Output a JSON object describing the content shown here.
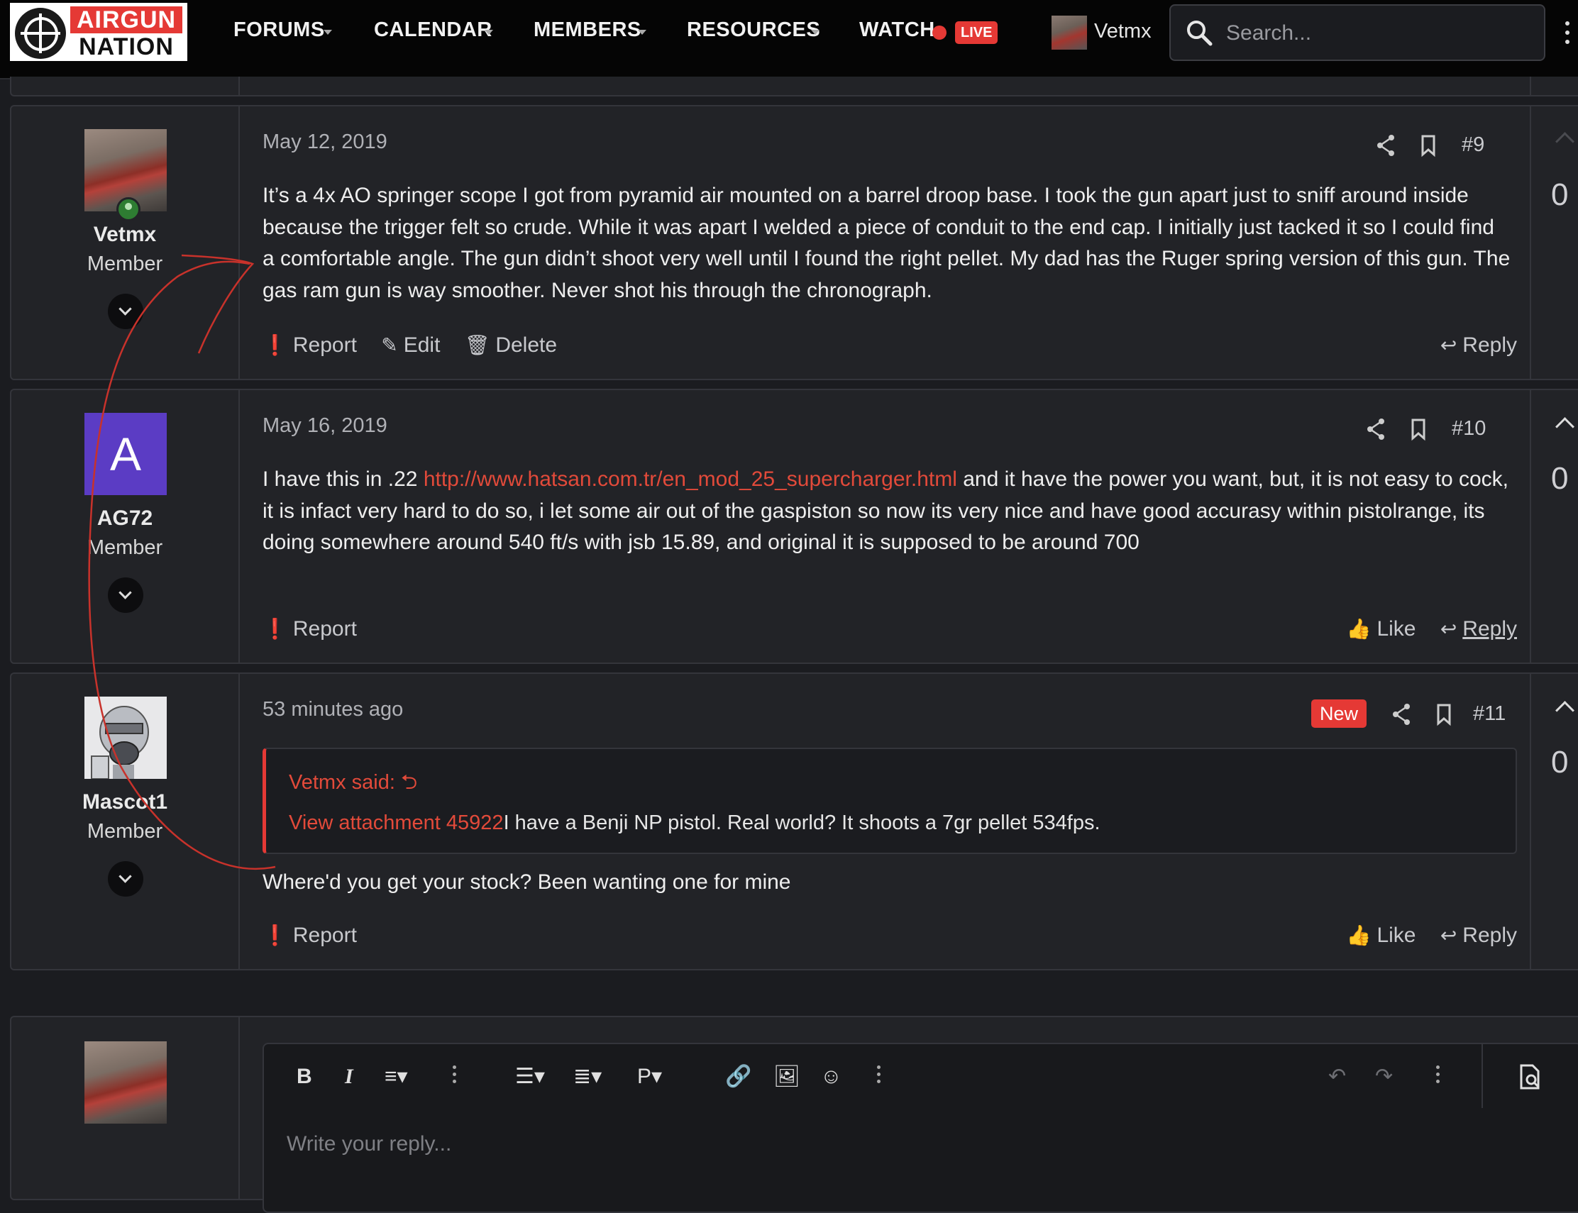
{
  "nav": {
    "logo_top": "AIRGUN",
    "logo_bottom": "NATION",
    "items": [
      "FORUMS",
      "CALENDAR",
      "MEMBERS",
      "RESOURCES"
    ],
    "watch": "WATCH",
    "live": "LIVE",
    "username": "Vetmx",
    "search_placeholder": "Search..."
  },
  "posts": [
    {
      "author": "Vetmx",
      "role": "Member",
      "date": "May 12, 2019",
      "number": "#9",
      "body": "It’s a 4x AO springer scope I got from pyramid air mounted on a barrel droop base. I took the gun apart just to sniff around inside because the trigger felt so crude. While it was apart I welded a piece of conduit to the end cap. I initially just tacked it so I could find a comfortable angle. The gun didn’t shoot very well until I found the right pellet. My dad has the Ruger spring version of this gun. The gas ram gun is way smoother. Never shot his through the chronograph.",
      "actions": [
        "Report",
        "Edit",
        "Delete"
      ],
      "reply": "Reply",
      "votes": "0"
    },
    {
      "author": "AG72",
      "avatar_letter": "A",
      "role": "Member",
      "date": "May 16, 2019",
      "number": "#10",
      "body_before": "I have this in .22 ",
      "link": "http://www.hatsan.com.tr/en_mod_25_supercharger.html",
      "body_after": " and it have the power you want, but, it is not easy to cock, it is infact very hard to do so, i let some air out of the gaspiston so now its very nice and have good accurasy within pistolrange, its doing somewhere around 540 ft/s with jsb 15.89, and original it is supposed to be around 700",
      "report": "Report",
      "like": "Like",
      "reply": "Reply",
      "votes": "0"
    },
    {
      "author": "Mascot1",
      "role": "Member",
      "date": "53 minutes ago",
      "badge": "New",
      "number": "#11",
      "quote_author": "Vetmx said:",
      "quote_link": "View attachment 45922",
      "quote_text": "I have a Benji NP pistol. Real world? It shoots a 7gr pellet 534fps.",
      "body": "Where'd you get your stock? Been wanting one for mine",
      "report": "Report",
      "like": "Like",
      "reply": "Reply",
      "votes": "0"
    }
  ],
  "editor": {
    "paragraph_tool": "P",
    "placeholder": "Write your reply..."
  },
  "colors": {
    "accent": "#e53935",
    "link": "#e24a3a",
    "background": "#1b1c20",
    "card": "#222327"
  }
}
